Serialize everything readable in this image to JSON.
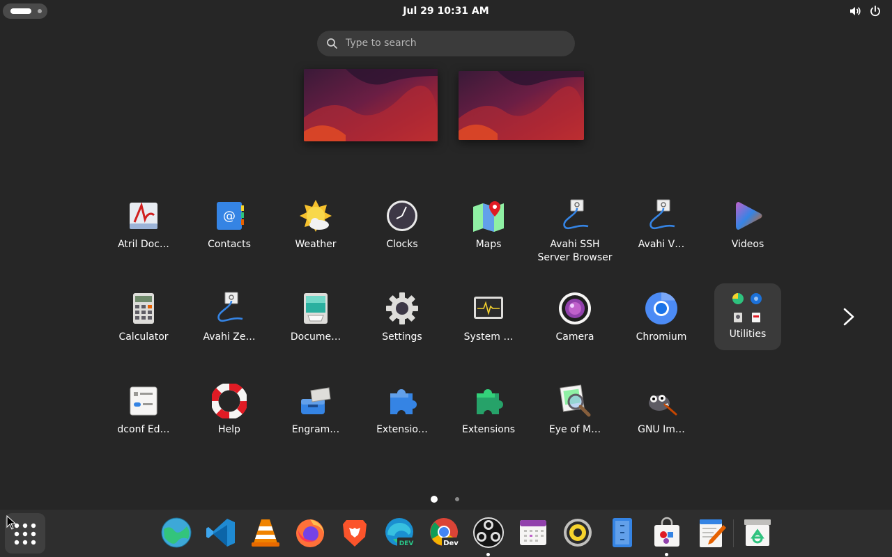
{
  "topbar": {
    "clock": "Jul 29  10:31 AM"
  },
  "icons": {
    "volume": "volume-icon",
    "power": "power-icon",
    "search": "search-icon"
  },
  "search": {
    "placeholder": "Type to search",
    "value": ""
  },
  "app_grid": {
    "rows": [
      [
        {
          "label": "Atril Doc…",
          "icon": "atril-icon"
        },
        {
          "label": "Contacts",
          "icon": "contacts-icon"
        },
        {
          "label": "Weather",
          "icon": "weather-icon"
        },
        {
          "label": "Clocks",
          "icon": "clocks-icon"
        },
        {
          "label": "Maps",
          "icon": "maps-icon"
        },
        {
          "label": "Avahi SSH Server Browser",
          "icon": "avahi-icon"
        },
        {
          "label": "Avahi V…",
          "icon": "avahi-icon"
        },
        {
          "label": "Videos",
          "icon": "videos-icon"
        }
      ],
      [
        {
          "label": "Calculator",
          "icon": "calculator-icon"
        },
        {
          "label": "Avahi Ze…",
          "icon": "avahi-icon"
        },
        {
          "label": "Docume…",
          "icon": "document-scanner-icon"
        },
        {
          "label": "Settings",
          "icon": "gear-icon"
        },
        {
          "label": "System …",
          "icon": "system-monitor-icon"
        },
        {
          "label": "Camera",
          "icon": "camera-icon"
        },
        {
          "label": "Chromium",
          "icon": "chromium-icon"
        },
        {
          "label": "Utilities",
          "icon": "folder-icon"
        }
      ],
      [
        {
          "label": "dconf Ed…",
          "icon": "dconf-editor-icon"
        },
        {
          "label": "Help",
          "icon": "help-lifebuoy-icon"
        },
        {
          "label": "Engram…",
          "icon": "engrampa-icon"
        },
        {
          "label": "Extensio…",
          "icon": "puzzle-piece-icon"
        },
        {
          "label": "Extensions",
          "icon": "puzzle-piece-icon"
        },
        {
          "label": "Eye of M…",
          "icon": "image-viewer-icon"
        },
        {
          "label": "GNU Im…",
          "icon": "gimp-icon"
        }
      ]
    ]
  },
  "pagination": {
    "pages": 2,
    "current": 1
  },
  "dock": {
    "items": [
      {
        "icon": "globe-browser-icon",
        "running": false
      },
      {
        "icon": "vscode-icon",
        "running": false
      },
      {
        "icon": "vlc-icon",
        "running": false
      },
      {
        "icon": "firefox-icon",
        "running": false
      },
      {
        "icon": "brave-icon",
        "running": false
      },
      {
        "icon": "edge-dev-icon",
        "badge": "DEV",
        "running": false
      },
      {
        "icon": "chrome-dev-icon",
        "badge": "Dev",
        "running": false
      },
      {
        "icon": "obs-icon",
        "running": true
      },
      {
        "icon": "calendar-icon",
        "running": false
      },
      {
        "icon": "speaker-icon",
        "running": false
      },
      {
        "icon": "file-manager-icon",
        "running": false
      },
      {
        "icon": "software-store-icon",
        "running": true
      },
      {
        "icon": "text-editor-icon",
        "running": false
      },
      {
        "icon": "trash-icon",
        "running": false
      }
    ]
  },
  "colors": {
    "background": "#262626",
    "panel": "#2e2e2e",
    "search_bg": "#3b3b3b",
    "folder_bg": "#3a3a3a",
    "text": "#ffffff",
    "placeholder": "#b5b5b5"
  }
}
